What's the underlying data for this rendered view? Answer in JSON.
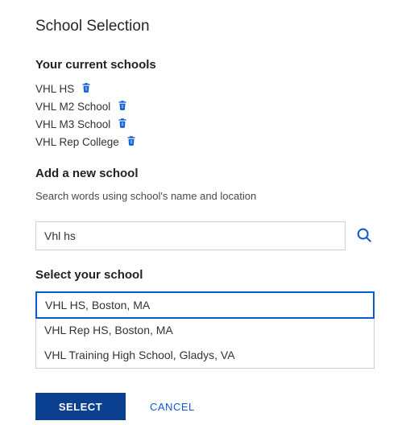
{
  "page_title": "School Selection",
  "current_schools": {
    "heading": "Your current schools",
    "items": [
      {
        "name": "VHL HS"
      },
      {
        "name": "VHL M2 School"
      },
      {
        "name": "VHL M3 School"
      },
      {
        "name": "VHL Rep College"
      }
    ]
  },
  "add_school": {
    "heading": "Add a new school",
    "helper": "Search words using school's name and location",
    "search_value": "Vhl hs"
  },
  "select_school": {
    "heading": "Select your school",
    "results": [
      {
        "label": "VHL HS, Boston, MA",
        "selected": true
      },
      {
        "label": "VHL Rep HS, Boston, MA",
        "selected": false
      },
      {
        "label": "VHL Training High School, Gladys, VA",
        "selected": false
      }
    ]
  },
  "buttons": {
    "select": "SELECT",
    "cancel": "CANCEL"
  },
  "colors": {
    "accent": "#0b5bd3",
    "primary_btn": "#0b3f8f"
  }
}
